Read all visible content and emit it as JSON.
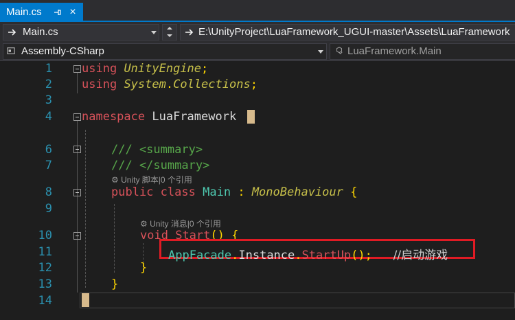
{
  "tab": {
    "title": "Main.cs",
    "pin": "pin-icon",
    "close": "×"
  },
  "nav1": {
    "file": "Main.cs",
    "path": "E:\\UnityProject\\LuaFramework_UGUI-master\\Assets\\LuaFramework"
  },
  "nav2": {
    "project": "Assembly-CSharp",
    "member": "LuaFramework.Main"
  },
  "hints": {
    "class_hint": "Unity 脚本|0 个引用",
    "method_hint": "Unity 消息|0 个引用"
  },
  "code": {
    "l1": {
      "kw": "using",
      "ns": "UnityEngine",
      "end": ";"
    },
    "l2": {
      "kw": "using",
      "ns1": "System",
      "dot": ".",
      "ns2": "Collections",
      "end": ";"
    },
    "l4": {
      "kw": "namespace",
      "name": "LuaFramework"
    },
    "l6": "/// <summary>",
    "l7": "/// </summary>",
    "l8": {
      "kw1": "public",
      "kw2": "class",
      "name": "Main",
      "colon": ":",
      "base": "MonoBehaviour",
      "brace": "{"
    },
    "l10": {
      "kw": "void",
      "name": "Start",
      "paren": "()",
      "brace": "{"
    },
    "l11": {
      "obj": "AppFacade",
      "dot1": ".",
      "prop": "Instance",
      "dot2": ".",
      "call": "StartUp",
      "tail": "();",
      "comment": "//启动游戏"
    },
    "l12": "}",
    "l13": "}"
  },
  "line_numbers": [
    "1",
    "2",
    "3",
    "4",
    "6",
    "7",
    "8",
    "9",
    "10",
    "11",
    "12",
    "13",
    "14"
  ],
  "highlight_color": "#e01b24"
}
